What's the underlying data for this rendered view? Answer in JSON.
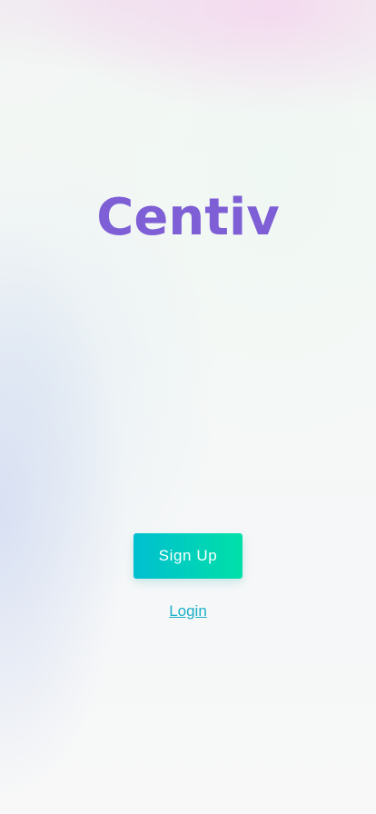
{
  "app": {
    "logo_text": "Centiv"
  },
  "actions": {
    "signup_label": "Sign Up",
    "login_label": "Login"
  },
  "colors": {
    "brand": "#7e5fd5",
    "button_gradient_start": "#00bfd0",
    "button_gradient_end": "#00e0a8",
    "link": "#1ab0c8"
  }
}
